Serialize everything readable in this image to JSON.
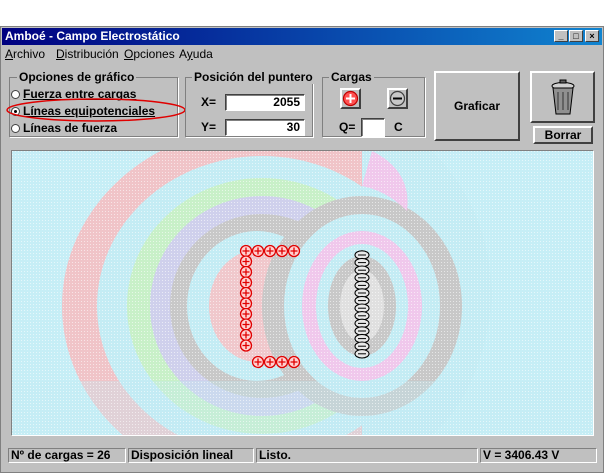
{
  "window": {
    "title": "Amboé  - Campo Electrostático"
  },
  "menu": [
    {
      "label": "Archivo",
      "accel": "A"
    },
    {
      "label": "Distribución",
      "accel": "D"
    },
    {
      "label": "Opciones",
      "accel": "O"
    },
    {
      "label": "Ayuda",
      "accel": "y"
    }
  ],
  "graph_options": {
    "title": "Opciones de gráfico",
    "items": [
      {
        "label": "Fuerza entre cargas",
        "checked": false
      },
      {
        "label": "Líneas equipotenciales",
        "checked": true
      },
      {
        "label": "Líneas de fuerza",
        "checked": false
      }
    ]
  },
  "pointer": {
    "title": "Posición del puntero",
    "x_label": "X=",
    "x_value": "2055",
    "y_label": "Y=",
    "y_value": "30"
  },
  "charges": {
    "title": "Cargas",
    "plus_icon": "plus-circle-icon",
    "minus_icon": "minus-circle-icon",
    "q_label": "Q=",
    "q_value": "",
    "unit": "C"
  },
  "graficar_label": "Graficar",
  "borrar_label": "Borrar",
  "status": {
    "count": "Nº  de cargas = 26",
    "layout": "Disposición lineal",
    "state": "Listo.",
    "voltage": "V = 3406.43 V"
  },
  "colors": {
    "positive": "#e00000",
    "title_bar": "#000080",
    "highlight_ellipse": "#e00000"
  }
}
